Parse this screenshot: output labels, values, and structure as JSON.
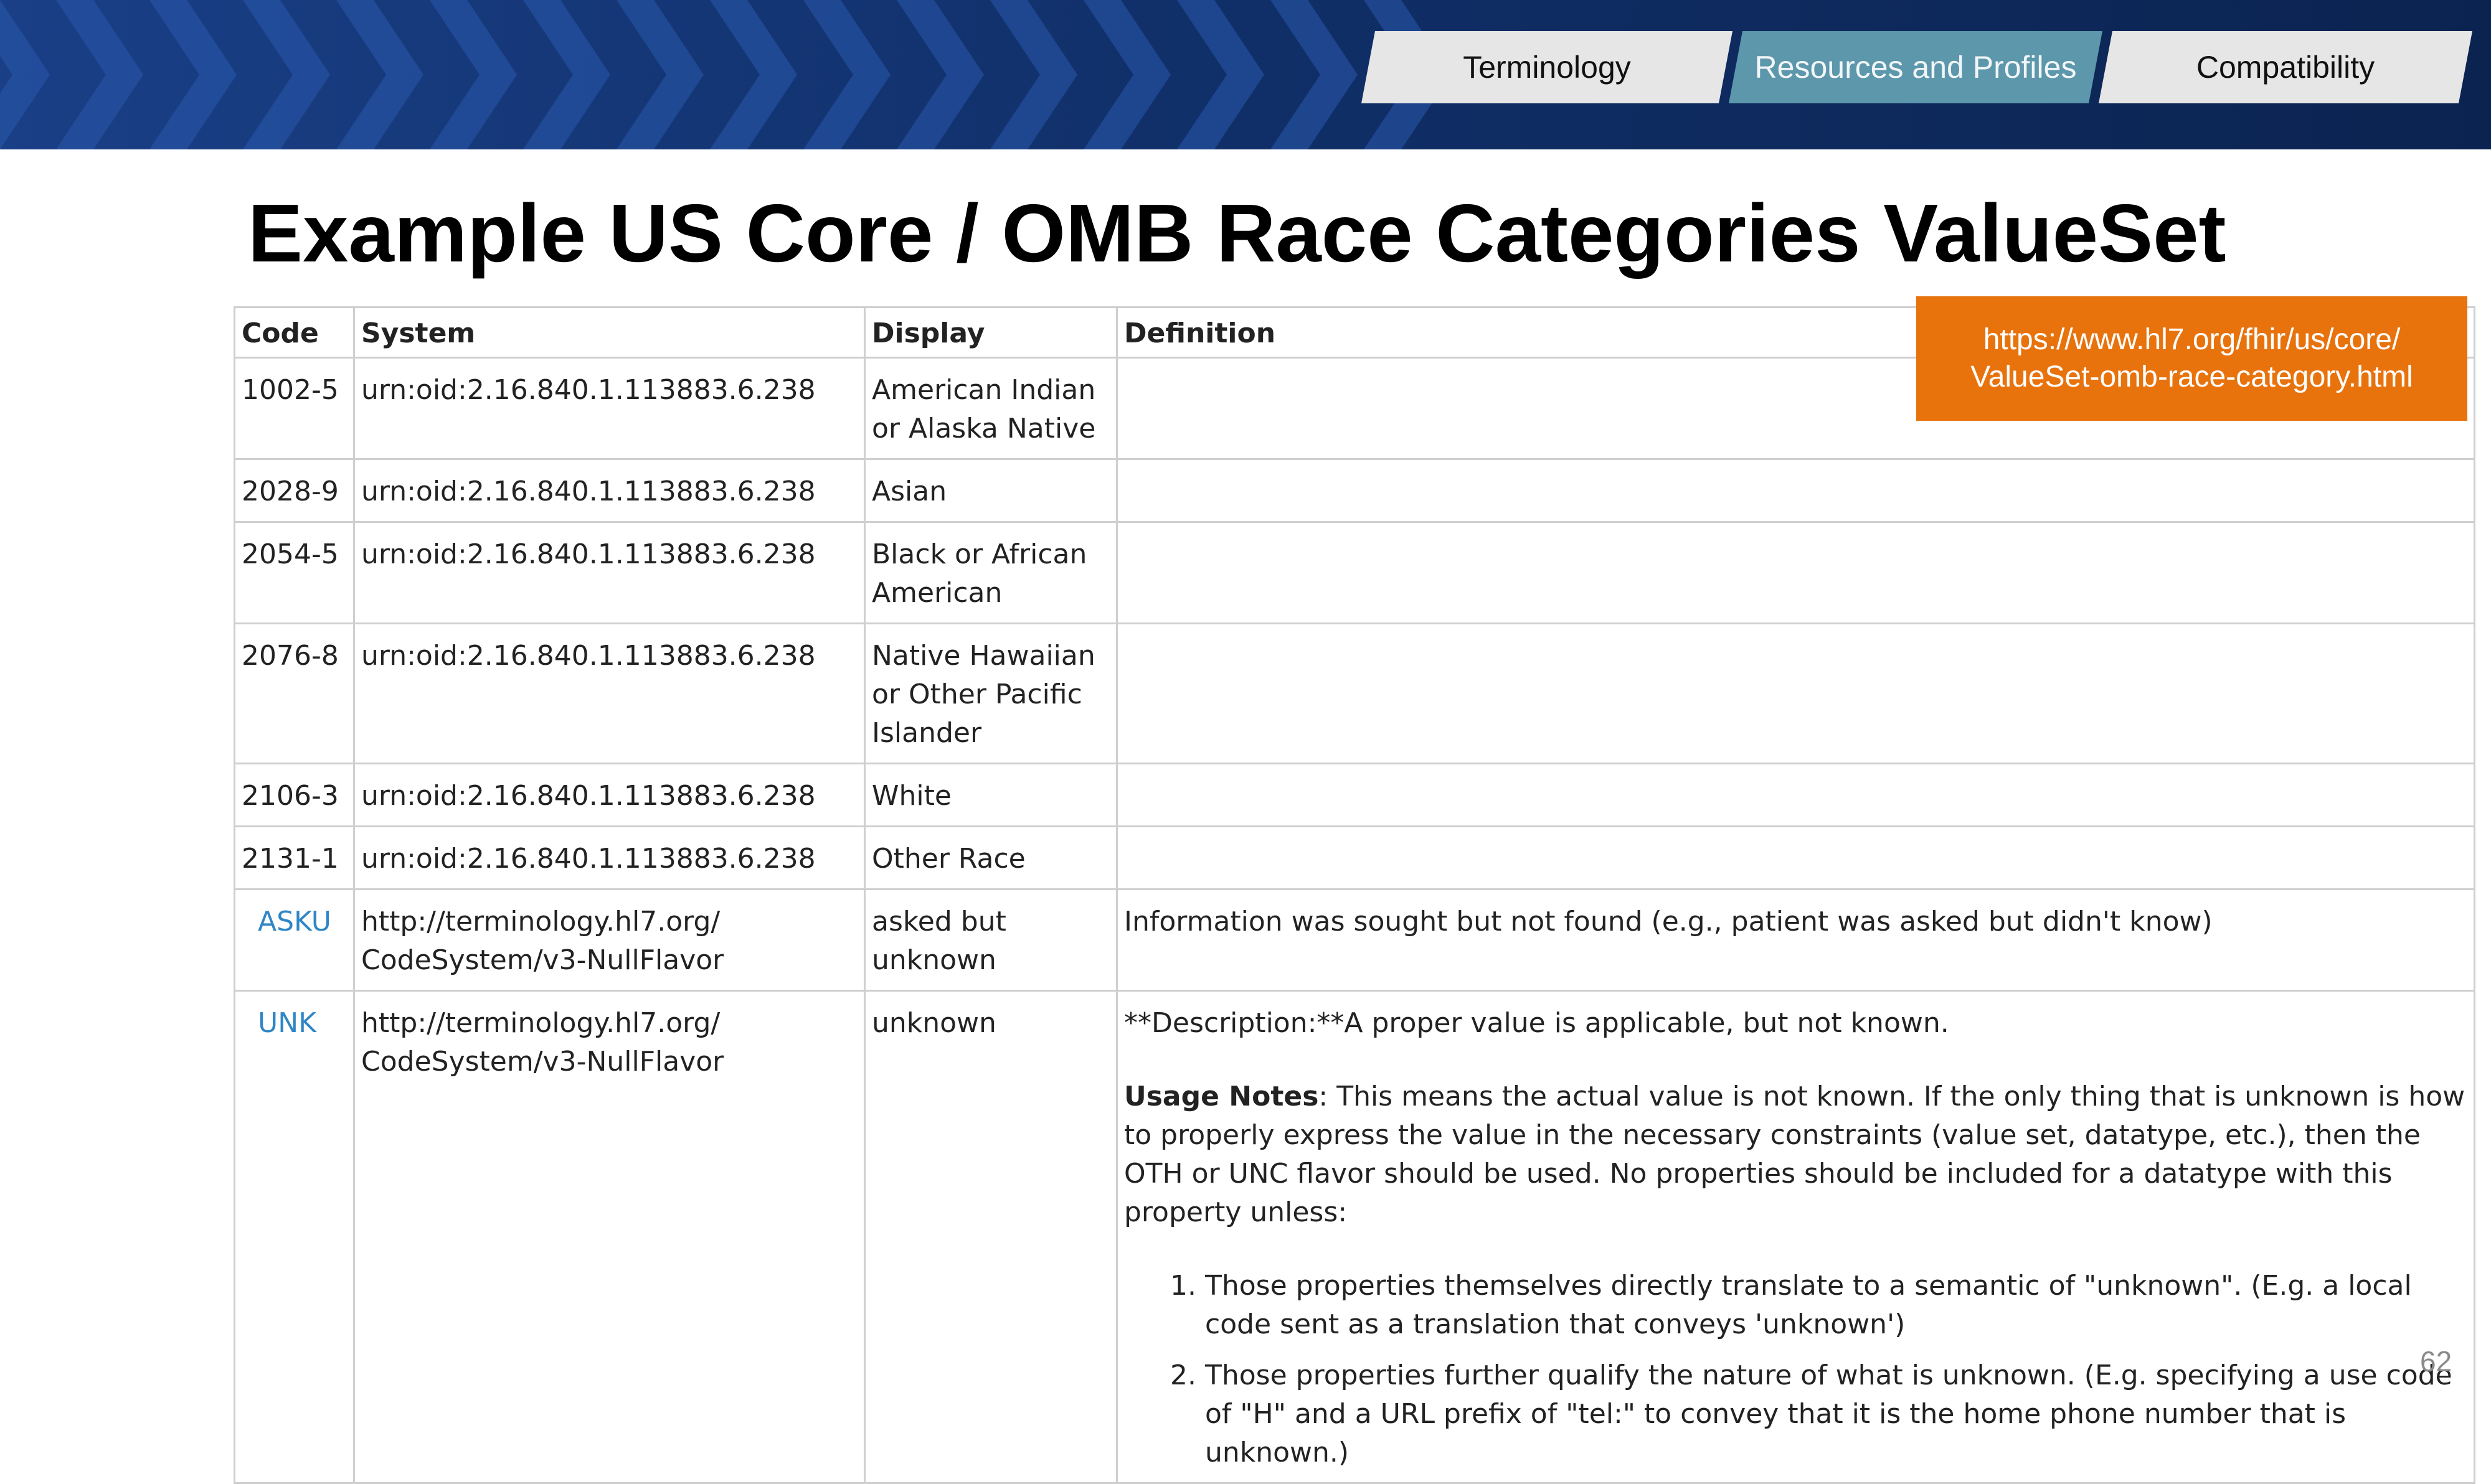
{
  "header": {
    "tabs": [
      {
        "label": "Terminology",
        "active": false
      },
      {
        "label": "Resources and Profiles",
        "active": true
      },
      {
        "label": "Compatibility",
        "active": false
      }
    ]
  },
  "title": "Example US Core / OMB Race Categories ValueSet",
  "url_box": {
    "line1": "https://www.hl7.org/fhir/us/core/",
    "line2": "ValueSet-omb-race-category.html"
  },
  "table": {
    "headers": {
      "code": "Code",
      "system": "System",
      "display": "Display",
      "definition": "Definition"
    },
    "rows": [
      {
        "code": "1002-5",
        "system": "urn:oid:2.16.840.1.113883.6.238",
        "display": "American Indian or Alaska Native",
        "definition": ""
      },
      {
        "code": "2028-9",
        "system": "urn:oid:2.16.840.1.113883.6.238",
        "display": "Asian",
        "definition": ""
      },
      {
        "code": "2054-5",
        "system": "urn:oid:2.16.840.1.113883.6.238",
        "display": "Black or African American",
        "definition": ""
      },
      {
        "code": "2076-8",
        "system": "urn:oid:2.16.840.1.113883.6.238",
        "display": "Native Hawaiian or Other Pacific Islander",
        "definition": ""
      },
      {
        "code": "2106-3",
        "system": "urn:oid:2.16.840.1.113883.6.238",
        "display": "White",
        "definition": ""
      },
      {
        "code": "2131-1",
        "system": "urn:oid:2.16.840.1.113883.6.238",
        "display": "Other Race",
        "definition": ""
      },
      {
        "code": "ASKU",
        "system_line1": "http://terminology.hl7.org/",
        "system_line2": "CodeSystem/v3-NullFlavor",
        "display": "asked but unknown",
        "definition": "Information was sought but not found (e.g., patient was asked but didn't know)"
      },
      {
        "code": "UNK",
        "system_line1": "http://terminology.hl7.org/",
        "system_line2": "CodeSystem/v3-NullFlavor",
        "display": "unknown",
        "description": "**Description:**A proper value is applicable, but not known.",
        "usage_label": "Usage Notes",
        "usage_text": ": This means the actual value is not known. If the only thing that is unknown is how to properly express the value in the necessary constraints (value set, datatype, etc.), then the OTH or UNC flavor should be used. No properties should be included for a datatype with this property unless:",
        "list": [
          "Those properties themselves directly translate to a semantic of \"unknown\". (E.g. a local code sent as a translation that conveys 'unknown')",
          "Those properties further qualify the nature of what is unknown. (E.g. specifying a use code of \"H\" and a URL prefix of \"tel:\" to convey that it is the home phone number that is unknown.)"
        ]
      }
    ]
  },
  "page_number": "62",
  "colors": {
    "banner": "#0d2a5c",
    "tab_active": "#5c97ab",
    "tab_inactive": "#e6e6e6",
    "url_box": "#e8720c",
    "link": "#2f86c6"
  }
}
